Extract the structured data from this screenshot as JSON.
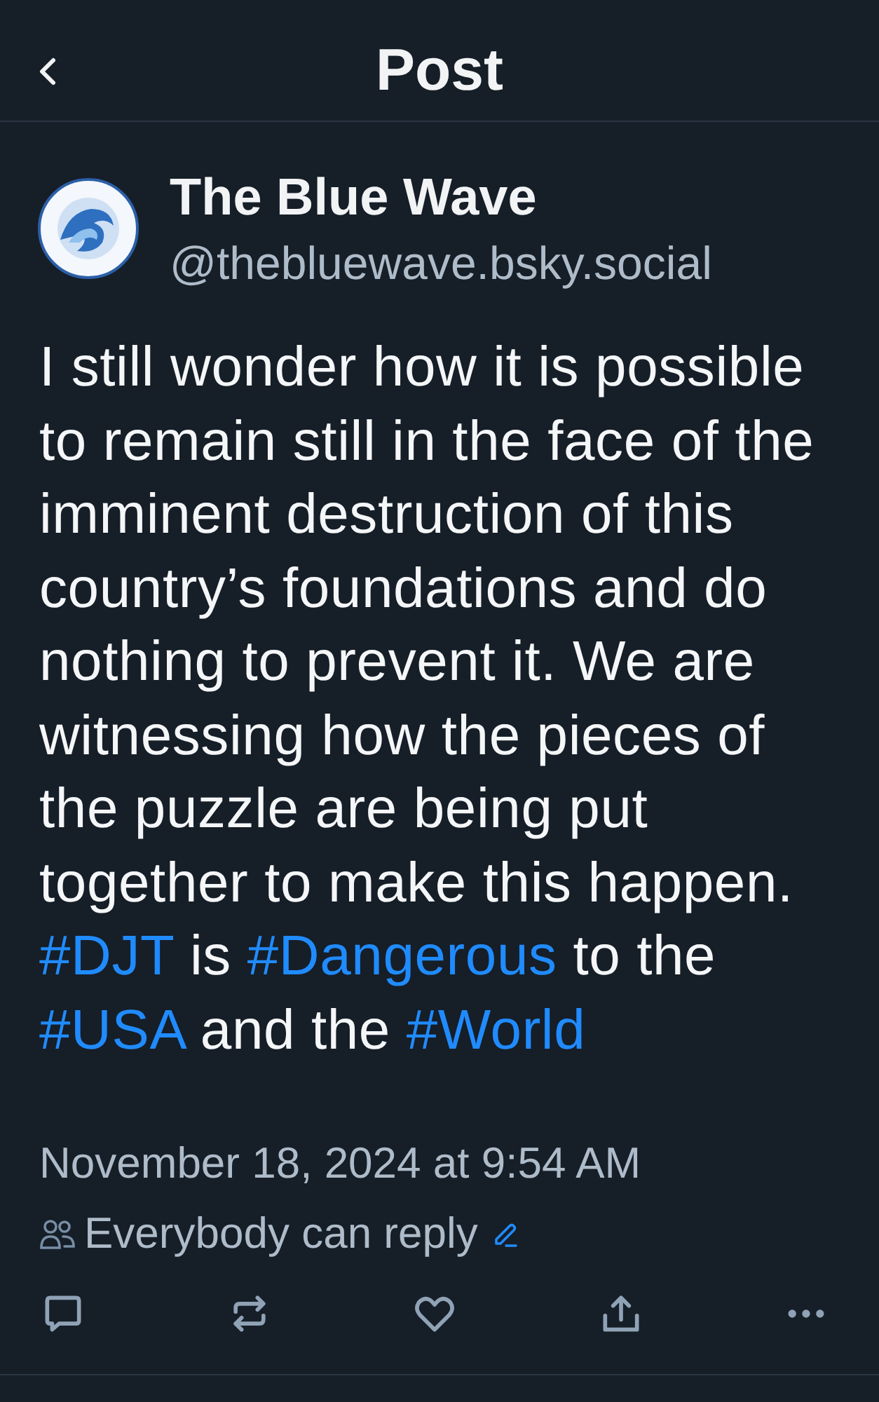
{
  "header": {
    "title": "Post"
  },
  "author": {
    "name": "The Blue Wave",
    "handle": "@thebluewave.bsky.social"
  },
  "body": [
    [
      {
        "kind": "text",
        "text": "I still wonder how it is possible"
      }
    ],
    [
      {
        "kind": "text",
        "text": "to remain still in the face of the"
      }
    ],
    [
      {
        "kind": "text",
        "text": "imminent destruction of this"
      }
    ],
    [
      {
        "kind": "text",
        "text": "country’s foundations and do"
      }
    ],
    [
      {
        "kind": "text",
        "text": "nothing to prevent it. We are"
      }
    ],
    [
      {
        "kind": "text",
        "text": "witnessing how the pieces of"
      }
    ],
    [
      {
        "kind": "text",
        "text": "the puzzle are being put"
      }
    ],
    [
      {
        "kind": "text",
        "text": "together to make this happen."
      }
    ],
    [
      {
        "kind": "hashtag",
        "text": "#DJT"
      },
      {
        "kind": "text",
        "text": " is "
      },
      {
        "kind": "hashtag",
        "text": "#Dangerous"
      },
      {
        "kind": "text",
        "text": " to the"
      }
    ],
    [
      {
        "kind": "hashtag",
        "text": "#USA"
      },
      {
        "kind": "text",
        "text": " and the "
      },
      {
        "kind": "hashtag",
        "text": "#World"
      }
    ]
  ],
  "timestamp": "November 18, 2024 at 9:54 AM",
  "reply_setting": {
    "label": "Everybody can reply"
  },
  "actions": [
    {
      "kind": "reply"
    },
    {
      "kind": "repost"
    },
    {
      "kind": "like"
    },
    {
      "kind": "share"
    },
    {
      "kind": "more"
    }
  ]
}
